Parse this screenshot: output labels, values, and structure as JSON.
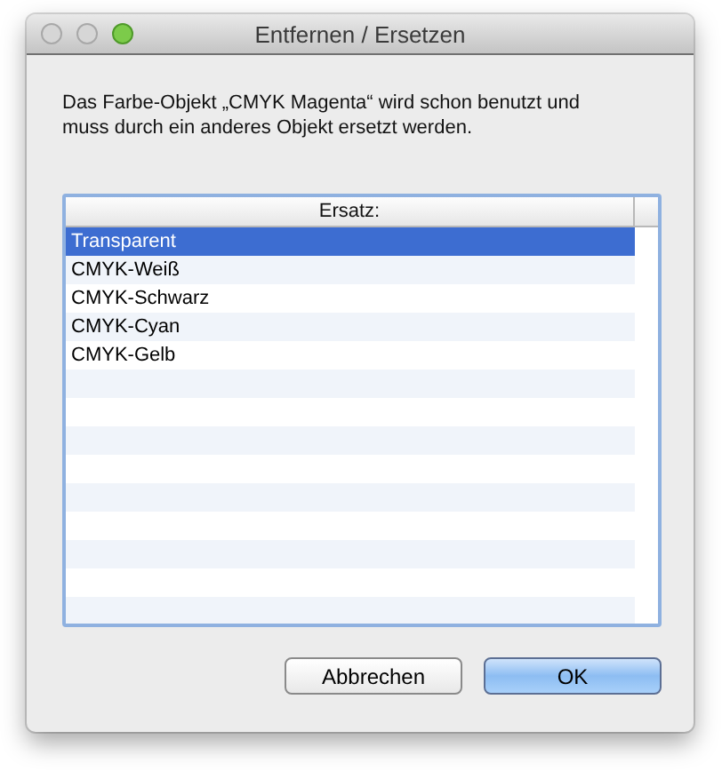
{
  "window": {
    "title": "Entfernen / Ersetzen"
  },
  "message": "Das Farbe-Objekt „CMYK Magenta“ wird schon benutzt und muss durch ein anderes Objekt ersetzt werden.",
  "table": {
    "columns": [
      "Ersatz:"
    ],
    "rows": [
      {
        "label": "Transparent",
        "selected": true
      },
      {
        "label": "CMYK-Weiß",
        "selected": false
      },
      {
        "label": "CMYK-Schwarz",
        "selected": false
      },
      {
        "label": "CMYK-Cyan",
        "selected": false
      },
      {
        "label": "CMYK-Gelb",
        "selected": false
      }
    ]
  },
  "buttons": [
    {
      "label": "Abbrechen",
      "kind": "cancel"
    },
    {
      "label": "OK",
      "kind": "default"
    }
  ]
}
